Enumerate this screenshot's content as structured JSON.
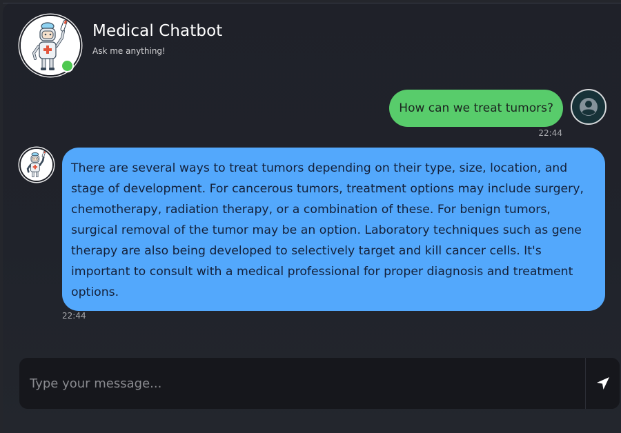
{
  "header": {
    "title": "Medical Chatbot",
    "subtitle": "Ask me anything!",
    "status": "online",
    "status_color": "#4ec850"
  },
  "messages": [
    {
      "sender": "user",
      "text": "How can we treat tumors?",
      "time": "22:44",
      "bubble_color": "#58cc6b",
      "avatar_icon": "user-icon"
    },
    {
      "sender": "bot",
      "text": "There are several ways to treat tumors depending on their type, size, location, and stage of development. For cancerous tumors, treatment options may include surgery, chemotherapy, radiation therapy, or a combination of these. For benign tumors, surgical removal of the tumor may be an option. Laboratory techniques such as gene therapy are also being developed to selectively target and kill cancer cells. It's important to consult with a medical professional for proper diagnosis and treatment options.",
      "time": "22:44",
      "bubble_color": "#53a8fc",
      "avatar_icon": "doctor-robot-icon"
    }
  ],
  "composer": {
    "placeholder": "Type your message...",
    "value": "",
    "send_icon": "send-icon"
  }
}
